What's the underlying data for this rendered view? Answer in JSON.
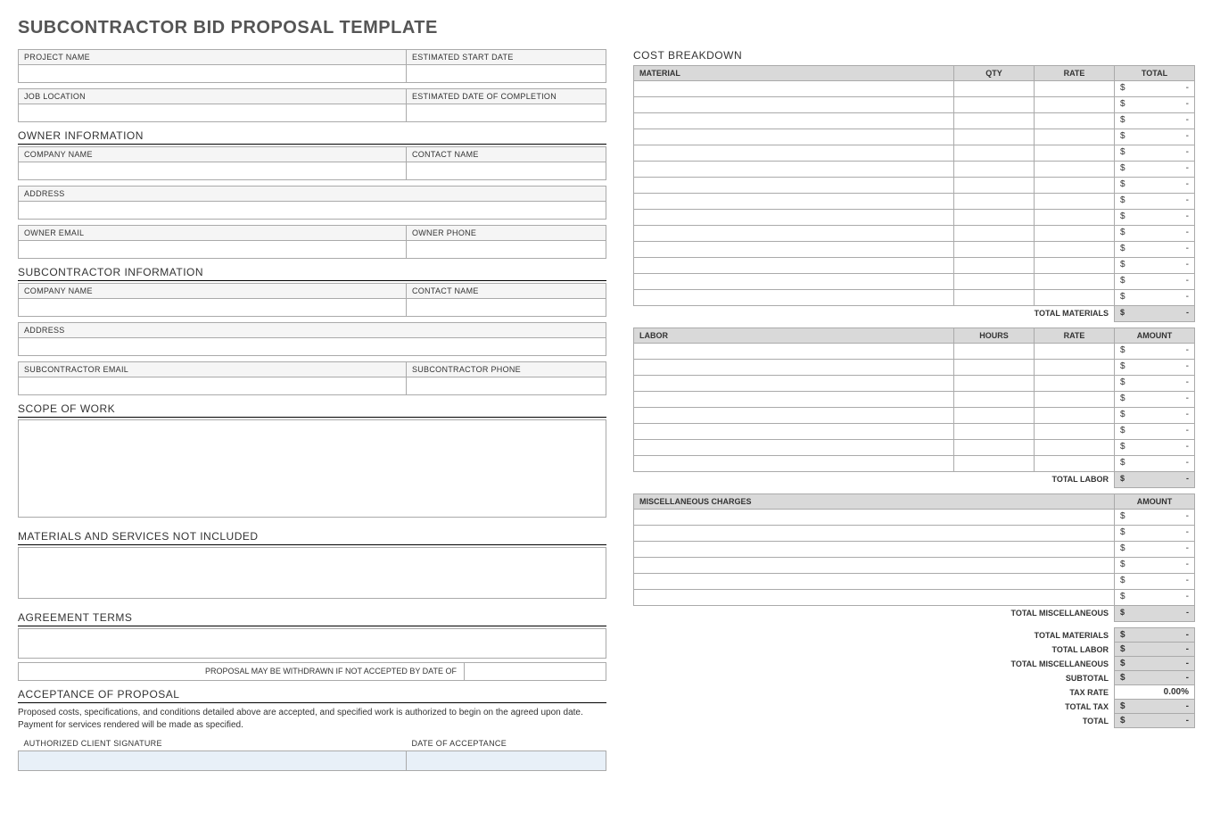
{
  "title": "SUBCONTRACTOR BID PROPOSAL TEMPLATE",
  "left": {
    "project_name_label": "PROJECT NAME",
    "est_start_label": "ESTIMATED START DATE",
    "job_location_label": "JOB LOCATION",
    "est_completion_label": "ESTIMATED DATE OF COMPLETION",
    "owner_info_title": "OWNER INFORMATION",
    "company_name_label": "COMPANY NAME",
    "contact_name_label": "CONTACT NAME",
    "address_label": "ADDRESS",
    "owner_email_label": "OWNER EMAIL",
    "owner_phone_label": "OWNER PHONE",
    "sub_info_title": "SUBCONTRACTOR INFORMATION",
    "sub_email_label": "SUBCONTRACTOR EMAIL",
    "sub_phone_label": "SUBCONTRACTOR PHONE",
    "scope_title": "SCOPE OF WORK",
    "notincl_title": "MATERIALS AND SERVICES NOT INCLUDED",
    "terms_title": "AGREEMENT TERMS",
    "withdraw_label": "PROPOSAL MAY BE WITHDRAWN IF NOT ACCEPTED BY DATE OF",
    "accept_title": "ACCEPTANCE OF PROPOSAL",
    "accept_text": "Proposed costs, specifications, and conditions detailed above are accepted, and specified work is authorized to begin on the agreed upon date.  Payment for services rendered will be made as specified.",
    "sig_label": "AUTHORIZED CLIENT SIGNATURE",
    "date_accept_label": "DATE OF ACCEPTANCE"
  },
  "cost": {
    "title": "COST BREAKDOWN",
    "material_header": "MATERIAL",
    "qty_header": "QTY",
    "rate_header": "RATE",
    "total_header": "TOTAL",
    "labor_header": "LABOR",
    "hours_header": "HOURS",
    "amount_header": "AMOUNT",
    "misc_header": "MISCELLANEOUS CHARGES",
    "currency": "$",
    "dash": "-",
    "material_rows": 14,
    "labor_rows": 8,
    "misc_rows": 6,
    "total_materials_label": "TOTAL MATERIALS",
    "total_labor_label": "TOTAL LABOR",
    "total_misc_label": "TOTAL MISCELLANEOUS",
    "subtotal_label": "SUBTOTAL",
    "tax_rate_label": "TAX RATE",
    "tax_rate_value": "0.00%",
    "total_tax_label": "TOTAL TAX",
    "total_label": "TOTAL"
  }
}
